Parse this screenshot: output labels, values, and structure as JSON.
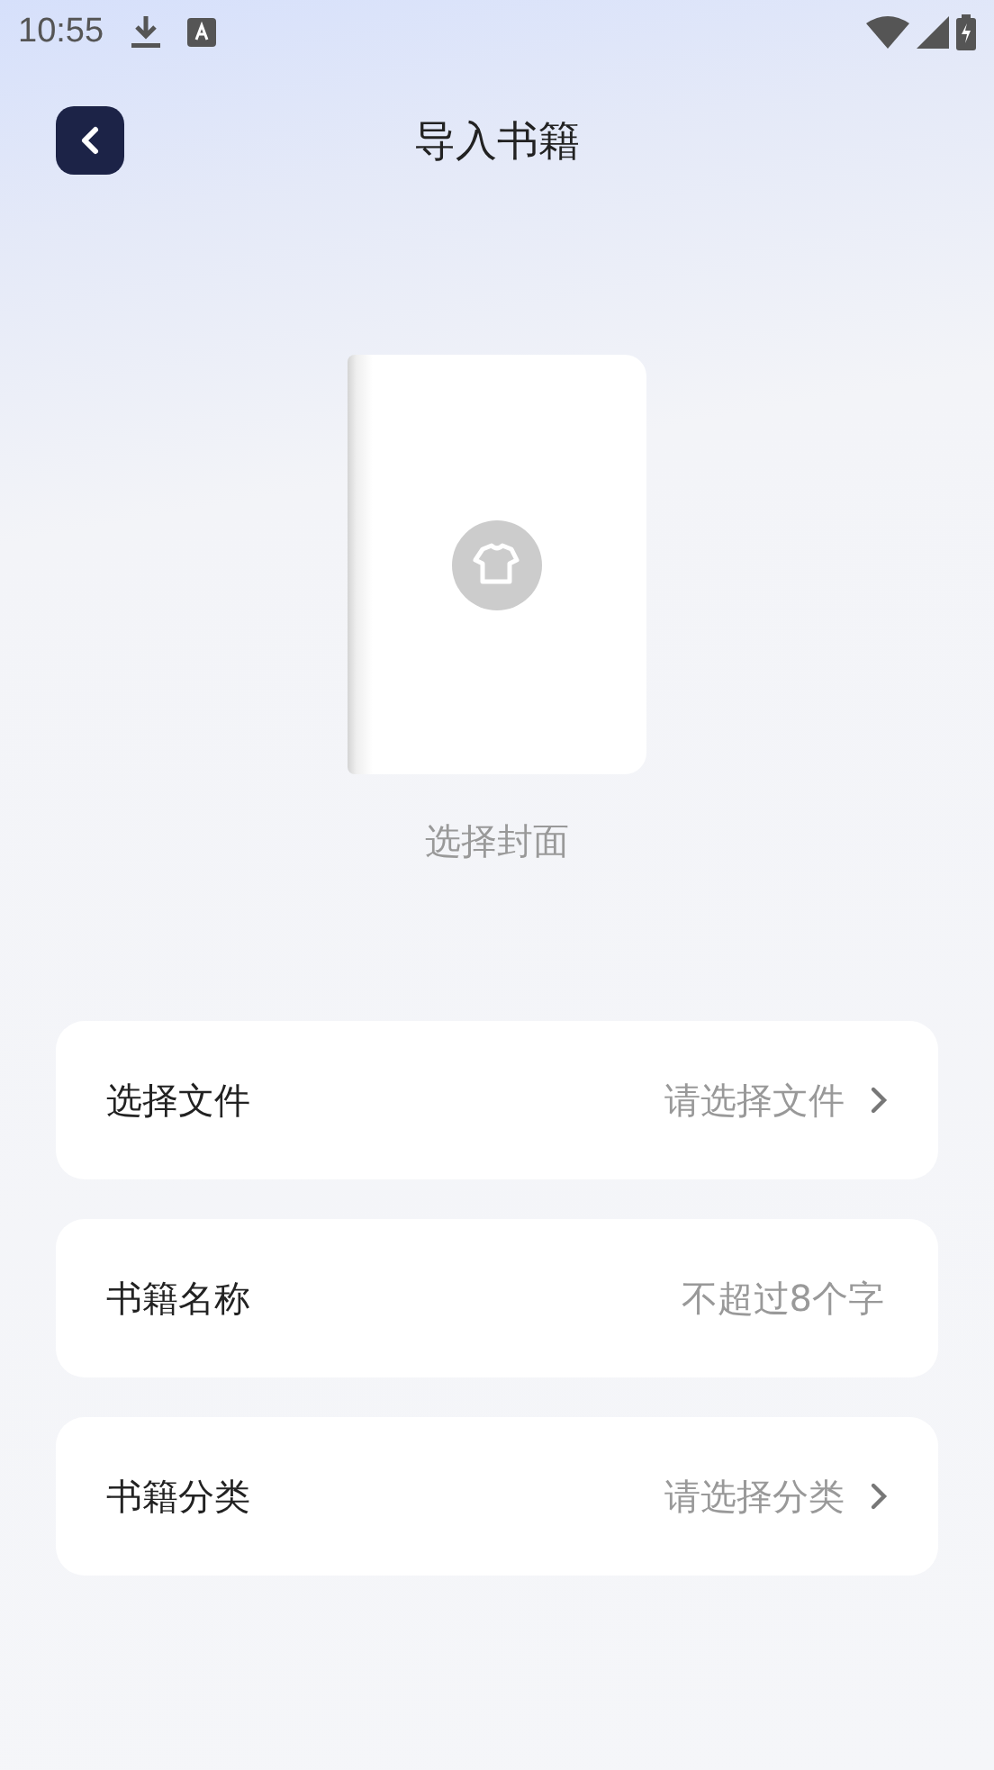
{
  "status_bar": {
    "time": "10:55"
  },
  "header": {
    "title": "导入书籍"
  },
  "cover": {
    "caption": "选择封面"
  },
  "fields": [
    {
      "kind": "select",
      "label": "选择文件",
      "placeholder": "请选择文件"
    },
    {
      "kind": "input",
      "label": "书籍名称",
      "placeholder": "不超过8个字"
    },
    {
      "kind": "select",
      "label": "书籍分类",
      "placeholder": "请选择分类"
    }
  ]
}
